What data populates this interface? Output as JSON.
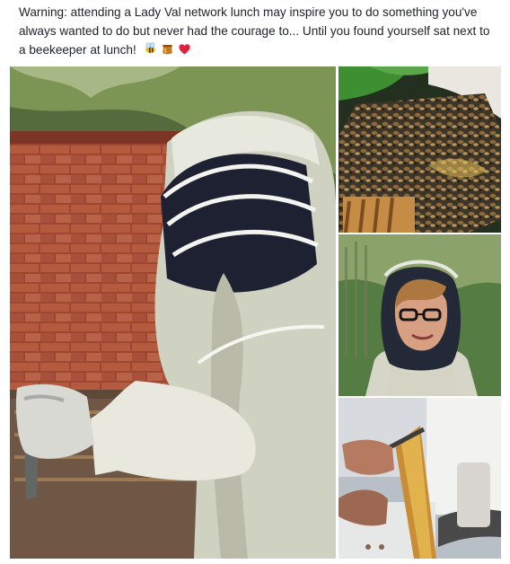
{
  "post": {
    "text": "Warning: attending a Lady Val network lunch may inspire you to do something you've always wanted to do but never had the courage to... Until you found yourself sat next to a beekeeper at lunch!",
    "emojis": [
      "bee-emoji",
      "honey-pot-emoji",
      "red-heart-emoji"
    ]
  },
  "photos": [
    {
      "name": "beekeeper-at-hive-photo",
      "layout": "main"
    },
    {
      "name": "bee-frame-photo",
      "layout": "tile"
    },
    {
      "name": "beekeeper-selfie-photo",
      "layout": "tile"
    },
    {
      "name": "honeycomb-frame-photo",
      "layout": "tile"
    }
  ],
  "colors": {
    "text": "#1d2129",
    "suit": "#d6d8c8",
    "brick": "#a24a35",
    "veil": "#1e2233"
  }
}
